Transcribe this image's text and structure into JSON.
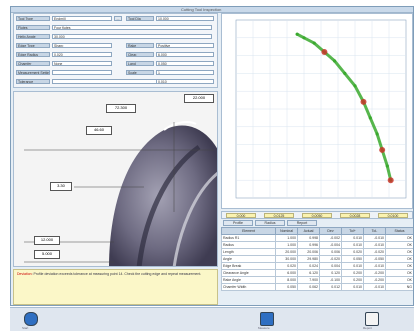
{
  "window": {
    "title": "Cutting Tool Inspection"
  },
  "form": {
    "rows": [
      {
        "label": "Tool Type",
        "value": "Endmill",
        "btn": "...",
        "label2": "Tool Dia",
        "value2": "10.000"
      },
      {
        "label": "Flutes",
        "value": "Four flutes",
        "btn": "",
        "label2": "",
        "value2": ""
      },
      {
        "label": "Helix Angle",
        "value": "30.000",
        "btn": "",
        "label2": "",
        "value2": ""
      },
      {
        "label": "Edge Type",
        "value": "Sharp",
        "btn": "",
        "label2": "Rake",
        "value2": "Positive"
      },
      {
        "label": "Edge Radius",
        "value": "0.020",
        "btn": "",
        "label2": "Clear.",
        "value2": "6.000"
      },
      {
        "label": "Chamfer",
        "value": "None",
        "btn": "",
        "label2": "Land",
        "value2": "0.050"
      },
      {
        "label": "Measurement Settings",
        "value": "",
        "btn": "",
        "label2": "Scale",
        "value2": "1"
      },
      {
        "label": "Tolerance",
        "value": "",
        "btn": "",
        "label2": "",
        "value2": "0.010"
      }
    ]
  },
  "image_panel": {
    "dims": [
      "72.300",
      "22.000",
      "46.60",
      "3.30",
      "12.000",
      "5.000"
    ]
  },
  "note": {
    "text": "Profile deviation exceeds tolerance at measuring point 14. Check the cutting edge and repeat measurement.",
    "highlight": "Deviation"
  },
  "status": {
    "values": [
      "0.000",
      "0.0125",
      "0.0050",
      "0.0028",
      "0.0100"
    ]
  },
  "tabs": [
    "Profile",
    "Radius",
    "Report"
  ],
  "table": {
    "headers": [
      "Element",
      "Nominal",
      "Actual",
      "Dev",
      "Tol+",
      "Tol-",
      "Status"
    ],
    "rows": [
      [
        "Radius R1",
        "1.000",
        "0.998",
        "-0.002",
        "0.010",
        "-0.010",
        "OK"
      ],
      [
        "Radius",
        "1.000",
        "0.996",
        "-0.004",
        "0.010",
        "-0.010",
        "OK"
      ],
      [
        "Length",
        "20.000",
        "20.006",
        "0.006",
        "0.020",
        "-0.020",
        "OK"
      ],
      [
        "Angle",
        "30.000",
        "29.980",
        "-0.020",
        "0.050",
        "-0.050",
        "OK"
      ],
      [
        "Edge Break",
        "0.020",
        "0.024",
        "0.004",
        "0.010",
        "-0.010",
        "OK"
      ],
      [
        "Clearance Angle",
        "6.000",
        "6.120",
        "0.120",
        "0.200",
        "-0.200",
        "OK"
      ],
      [
        "Rake Angle",
        "8.000",
        "7.900",
        "-0.100",
        "0.200",
        "-0.200",
        "OK"
      ],
      [
        "Chamfer Width",
        "0.050",
        "0.062",
        "0.012",
        "0.010",
        "-0.010",
        "NG"
      ]
    ]
  },
  "taskbar": {
    "items": [
      "Start",
      "Measure",
      "Report"
    ]
  },
  "colors": {
    "frame": "#7f9db9",
    "profile_green": "#3aa92e",
    "profile_red": "#c8362a",
    "grid": "#d8e4ef",
    "note_bg": "#fbf7c8"
  },
  "chart_data": {
    "type": "line",
    "title": "",
    "xlabel": "",
    "ylabel": "",
    "xlim": [
      0,
      10
    ],
    "ylim": [
      0,
      10
    ],
    "grid": true,
    "series": [
      {
        "name": "",
        "points": [
          [
            3.6,
            9.2
          ],
          [
            4.0,
            9.0
          ],
          [
            4.6,
            8.7
          ],
          [
            5.2,
            8.2
          ],
          [
            5.8,
            7.7
          ],
          [
            6.4,
            7.0
          ],
          [
            7.0,
            6.3
          ],
          [
            7.5,
            5.4
          ],
          [
            7.9,
            4.5
          ],
          [
            8.3,
            3.6
          ],
          [
            8.6,
            2.7
          ],
          [
            8.9,
            1.8
          ],
          [
            9.1,
            1.0
          ]
        ]
      }
    ],
    "deviation_markers": [
      [
        5.2,
        8.2
      ],
      [
        7.5,
        5.4
      ],
      [
        8.6,
        2.7
      ],
      [
        9.1,
        1.0
      ]
    ]
  }
}
